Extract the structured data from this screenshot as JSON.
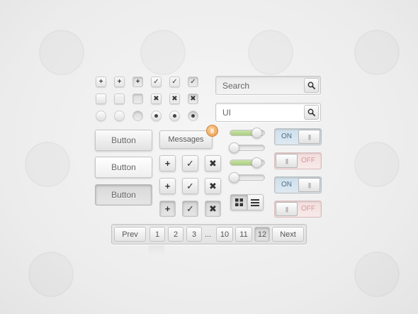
{
  "checkbox_rows": [
    [
      "+",
      "+",
      "+",
      "✓",
      "✓",
      "✓"
    ],
    [
      "",
      "",
      "",
      "✖",
      "✖",
      "✖"
    ]
  ],
  "radio_row_dots": [
    false,
    false,
    false,
    true,
    true,
    true
  ],
  "buttons": [
    "Button",
    "Button",
    "Button"
  ],
  "messages": {
    "label": "Messages",
    "count": "8"
  },
  "icon_buttons": [
    [
      "+",
      "✓",
      "✖"
    ],
    [
      "+",
      "✓",
      "✖"
    ],
    [
      "+",
      "✓",
      "✖"
    ]
  ],
  "search": {
    "value": "Search"
  },
  "search_ui": {
    "value": "UI"
  },
  "sliders": [
    {
      "fill": 0.8
    },
    {
      "fill": 0.1
    },
    {
      "fill": 0.8
    },
    {
      "fill": 0.1
    }
  ],
  "switches": [
    {
      "state": "on",
      "label": "ON",
      "grip": "|||"
    },
    {
      "state": "off",
      "label": "OFF",
      "grip": "|||"
    },
    {
      "state": "on",
      "label": "ON",
      "grip": "|||"
    },
    {
      "state": "off",
      "label": "OFF",
      "grip": "|||"
    }
  ],
  "pagination": {
    "prev": "Prev",
    "pages": [
      "1",
      "2",
      "3"
    ],
    "ellipsis": "...",
    "pages_tail": [
      "10",
      "11",
      "12"
    ],
    "current": "12",
    "next": "Next"
  },
  "icons": {
    "search": "search-icon",
    "grid_view": "grid-view-icon",
    "list_view": "list-view-icon"
  }
}
